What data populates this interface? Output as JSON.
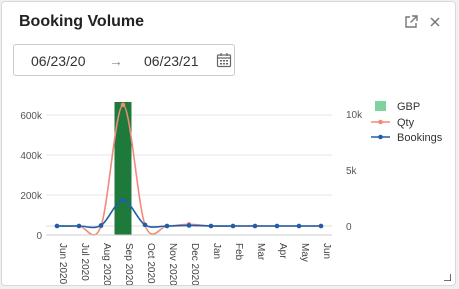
{
  "header": {
    "title": "Booking Volume"
  },
  "daterange": {
    "start": "06/23/20",
    "end": "06/23/21"
  },
  "icons": {
    "export": "external-link-icon",
    "close": "close-icon",
    "calendar": "calendar-icon"
  },
  "chart_data": {
    "type": "combo",
    "x": [
      "Jun 2020",
      "Jul 2020",
      "Aug 2020",
      "Sep 2020",
      "Oct 2020",
      "Nov 2020",
      "Dec 2020",
      "Jan",
      "Feb",
      "Mar",
      "Apr",
      "May",
      "Jun"
    ],
    "series": [
      {
        "name": "GBP",
        "type": "bar",
        "axis": "left",
        "color": "#1e7a3a",
        "legend_color": "#7fd39a",
        "values": [
          0,
          0,
          0,
          665000,
          0,
          0,
          0,
          0,
          0,
          0,
          0,
          0,
          0
        ]
      },
      {
        "name": "Qty",
        "type": "line",
        "axis": "right",
        "color": "#f08a7a",
        "values": [
          0,
          0,
          0,
          10800,
          100,
          0,
          150,
          0,
          0,
          0,
          0,
          0,
          0
        ]
      },
      {
        "name": "Bookings",
        "type": "line",
        "axis": "right",
        "color": "#1f5fa8",
        "values": [
          0,
          0,
          50,
          2300,
          100,
          0,
          50,
          0,
          0,
          0,
          0,
          0,
          0
        ]
      }
    ],
    "left_axis": {
      "ticks": [
        "0",
        "200k",
        "400k",
        "600k"
      ],
      "range": [
        0,
        660000
      ]
    },
    "right_axis": {
      "ticks": [
        "0",
        "5k",
        "10k"
      ],
      "range": [
        0,
        10700
      ]
    },
    "legend": "right",
    "grid": true
  }
}
